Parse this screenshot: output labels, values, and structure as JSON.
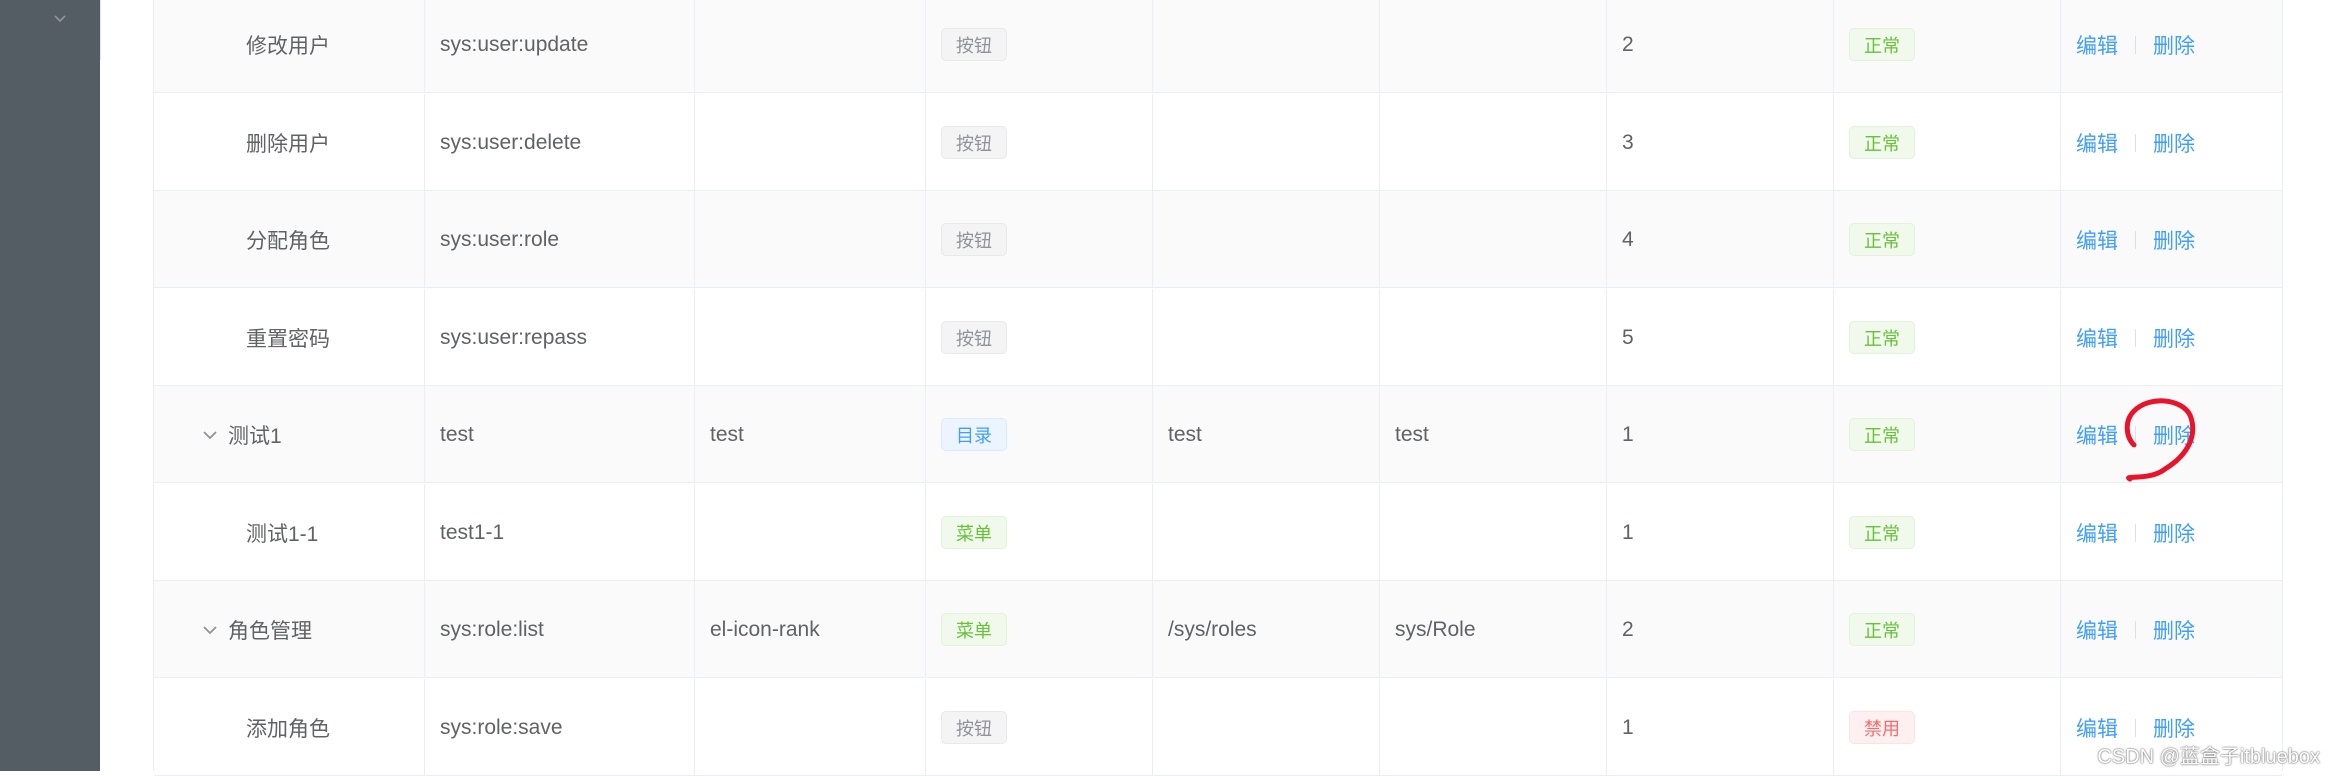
{
  "rows": [
    {
      "name": "修改用户",
      "perms": "sys:user:update",
      "icon": "",
      "type": "按钮",
      "type_style": "info",
      "path": "",
      "component": "",
      "order": "2",
      "status": "正常",
      "status_style": "success",
      "edit": "编辑",
      "delete": "删除",
      "level": "child",
      "alt": true
    },
    {
      "name": "删除用户",
      "perms": "sys:user:delete",
      "icon": "",
      "type": "按钮",
      "type_style": "info",
      "path": "",
      "component": "",
      "order": "3",
      "status": "正常",
      "status_style": "success",
      "edit": "编辑",
      "delete": "删除",
      "level": "child",
      "alt": false
    },
    {
      "name": "分配角色",
      "perms": "sys:user:role",
      "icon": "",
      "type": "按钮",
      "type_style": "info",
      "path": "",
      "component": "",
      "order": "4",
      "status": "正常",
      "status_style": "success",
      "edit": "编辑",
      "delete": "删除",
      "level": "child",
      "alt": true
    },
    {
      "name": "重置密码",
      "perms": "sys:user:repass",
      "icon": "",
      "type": "按钮",
      "type_style": "info",
      "path": "",
      "component": "",
      "order": "5",
      "status": "正常",
      "status_style": "success",
      "edit": "编辑",
      "delete": "删除",
      "level": "child",
      "alt": false
    },
    {
      "name": "测试1",
      "perms": "test",
      "icon": "test",
      "type": "目录",
      "type_style": "primary",
      "path": "test",
      "component": "test",
      "order": "1",
      "status": "正常",
      "status_style": "success",
      "edit": "编辑",
      "delete": "删除",
      "level": "parent",
      "alt": true
    },
    {
      "name": "测试1-1",
      "perms": "test1-1",
      "icon": "",
      "type": "菜单",
      "type_style": "success",
      "path": "",
      "component": "",
      "order": "1",
      "status": "正常",
      "status_style": "success",
      "edit": "编辑",
      "delete": "删除",
      "level": "child",
      "alt": false
    },
    {
      "name": "角色管理",
      "perms": "sys:role:list",
      "icon": "el-icon-rank",
      "type": "菜单",
      "type_style": "success",
      "path": "/sys/roles",
      "component": "sys/Role",
      "order": "2",
      "status": "正常",
      "status_style": "success",
      "edit": "编辑",
      "delete": "删除",
      "level": "parent",
      "alt": true
    },
    {
      "name": "添加角色",
      "perms": "sys:role:save",
      "icon": "",
      "type": "按钮",
      "type_style": "info",
      "path": "",
      "component": "",
      "order": "1",
      "status": "禁用",
      "status_style": "danger",
      "edit": "编辑",
      "delete": "删除",
      "level": "child",
      "alt": false
    }
  ],
  "icons": {
    "sidebar_collapse": "chevron-down-icon",
    "row_expand": "chevron-down-icon"
  },
  "annotation_color": "#e8142c",
  "watermark": "CSDN @蓝盒子itbluebox"
}
